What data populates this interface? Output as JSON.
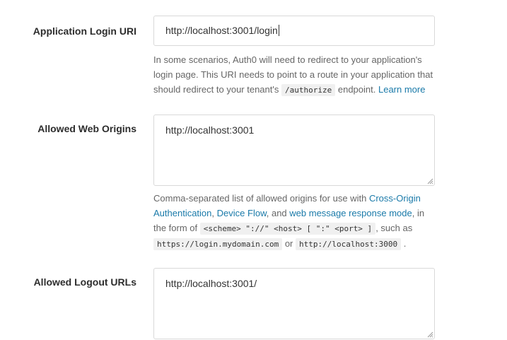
{
  "login_uri": {
    "label": "Application Login URI",
    "value": "http://localhost:3001/login",
    "help_prefix": "In some scenarios, Auth0 will need to redirect to your application's login page. This URI needs to point to a route in your application that should redirect to your tenant's",
    "help_code": "/authorize",
    "help_suffix": "endpoint.",
    "learn_more": "Learn more"
  },
  "web_origins": {
    "label": "Allowed Web Origins",
    "value": "http://localhost:3001",
    "help_1": "Comma-separated list of allowed origins for use with",
    "link_cors": "Cross-Origin Authentication",
    "sep_1": ",",
    "link_device": "Device Flow",
    "sep_2": ", and",
    "link_wmrm": "web message response mode",
    "help_2": ", in the form of",
    "code_format": "<scheme> \"://\" <host> [ \":\" <port> ]",
    "help_3": ", such as",
    "code_example_1": "https://login.mydomain.com",
    "help_or": "or",
    "code_example_2": "http://localhost:3000",
    "help_end": "."
  },
  "logout_urls": {
    "label": "Allowed Logout URLs",
    "value": "http://localhost:3001/"
  }
}
